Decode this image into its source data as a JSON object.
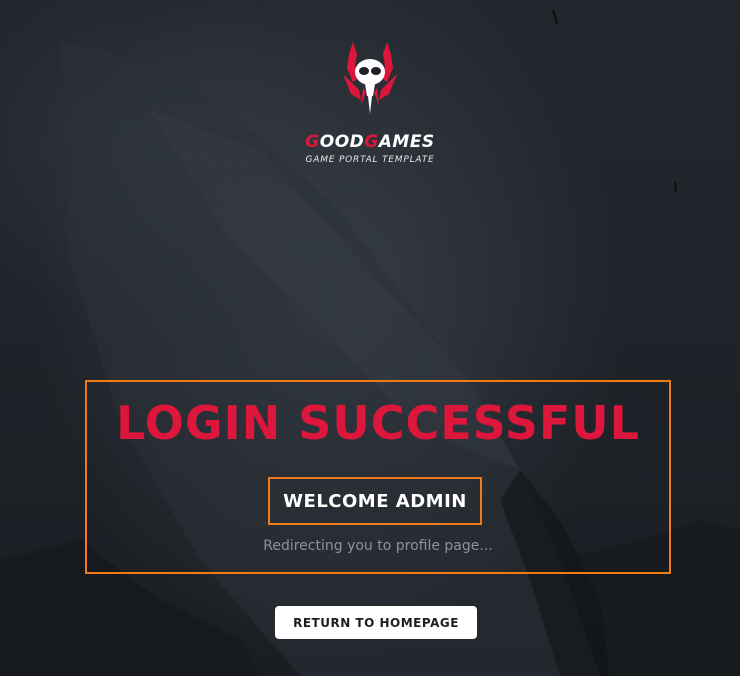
{
  "brand": {
    "title_first_letter": "G",
    "title_part1": "OOD",
    "title_second_letter": "G",
    "title_part2": "AMES",
    "subtitle": "GAME PORTAL TEMPLATE",
    "icon": "skull-logo-icon"
  },
  "result": {
    "headline": "LOGIN SUCCESSFUL",
    "welcome": "WELCOME ADMIN",
    "redirect_message": "Redirecting you to profile page..."
  },
  "actions": {
    "return_home_label": "RETURN TO HOMEPAGE"
  },
  "colors": {
    "accent_red": "#dd163b",
    "frame_orange": "#f07b16",
    "background": "#1d2228"
  }
}
